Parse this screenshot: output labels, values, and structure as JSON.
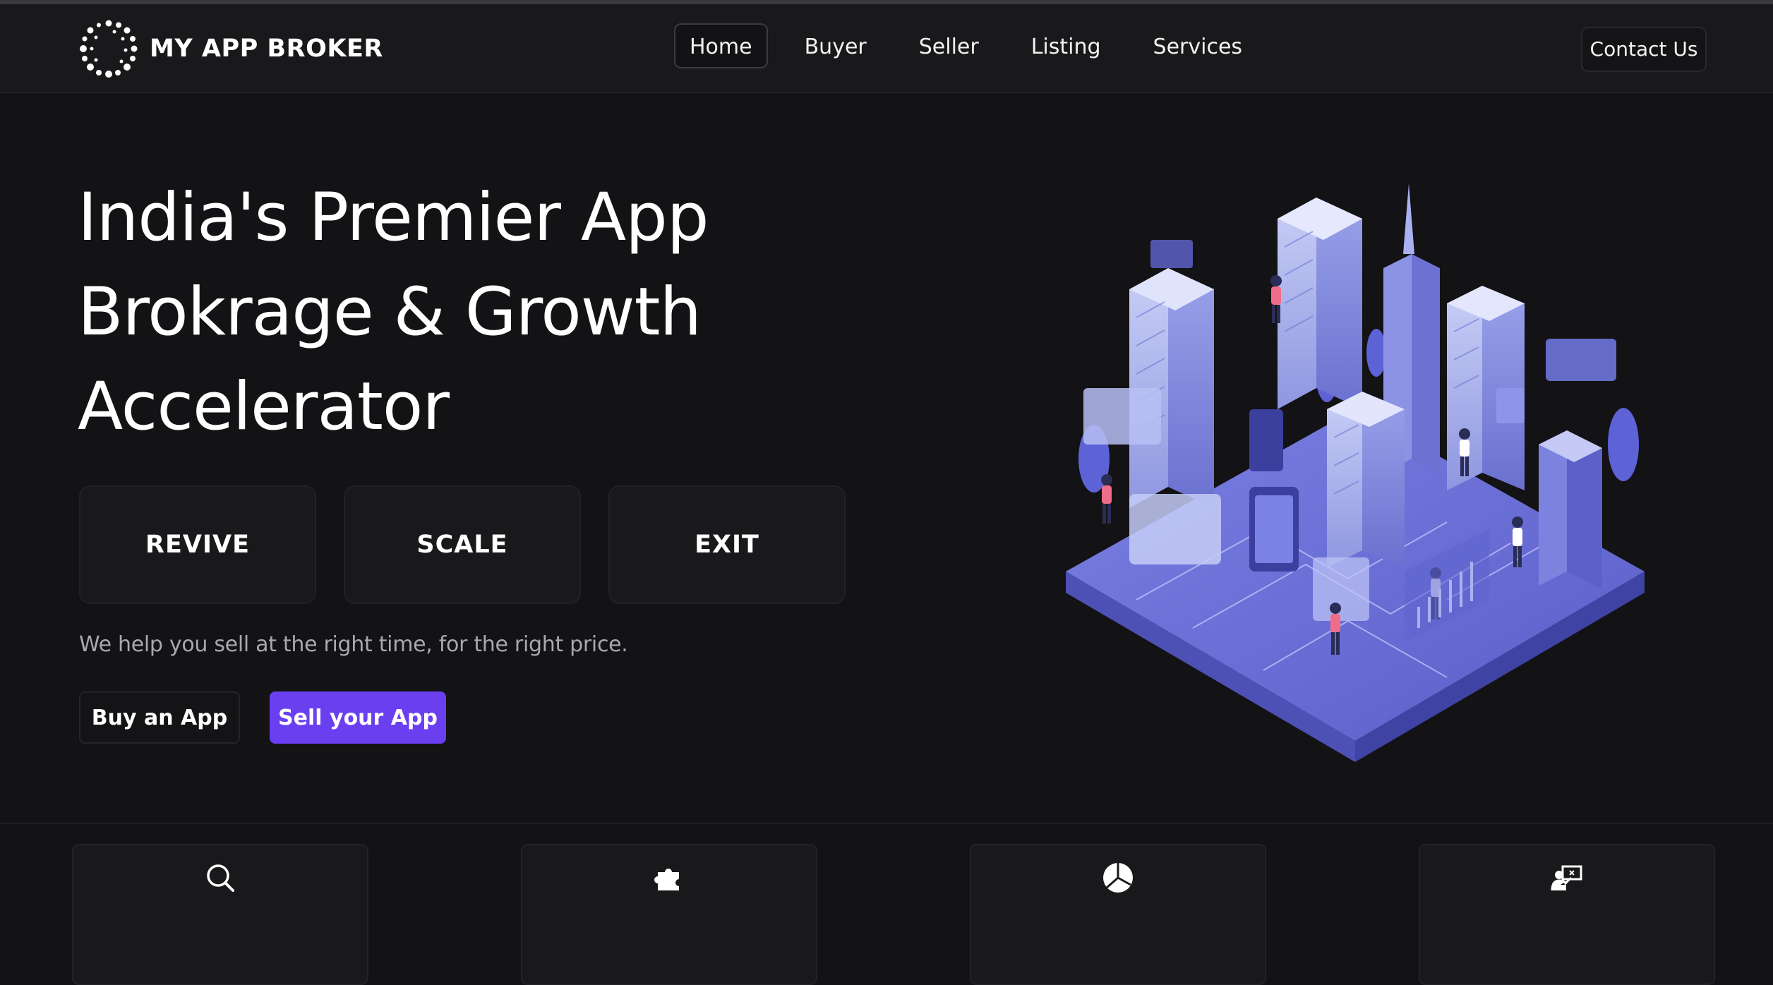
{
  "brand": {
    "name": "MY APP BROKER"
  },
  "nav": {
    "items": [
      {
        "label": "Home",
        "active": true
      },
      {
        "label": "Buyer",
        "active": false
      },
      {
        "label": "Seller",
        "active": false
      },
      {
        "label": "Listing",
        "active": false
      },
      {
        "label": "Services",
        "active": false
      }
    ],
    "contact_label": "Contact Us"
  },
  "hero": {
    "title_lines": [
      "India's Premier App",
      "Brokrage & Growth",
      "Accelerator"
    ],
    "pillars": [
      "REVIVE",
      "SCALE",
      "EXIT"
    ],
    "subtitle": "We help you sell at the right time, for the right price.",
    "buy_label": "Buy an App",
    "sell_label": "Sell your App"
  },
  "features": [
    {
      "icon": "search-icon",
      "label": ""
    },
    {
      "icon": "puzzle-icon",
      "label": ""
    },
    {
      "icon": "pie-chart-icon",
      "label": ""
    },
    {
      "icon": "presentation-icon",
      "label": ""
    }
  ],
  "colors": {
    "background": "#131214",
    "navbar": "#19181a",
    "accent": "#6a3ff0",
    "illustration": "#6b6fd6"
  }
}
